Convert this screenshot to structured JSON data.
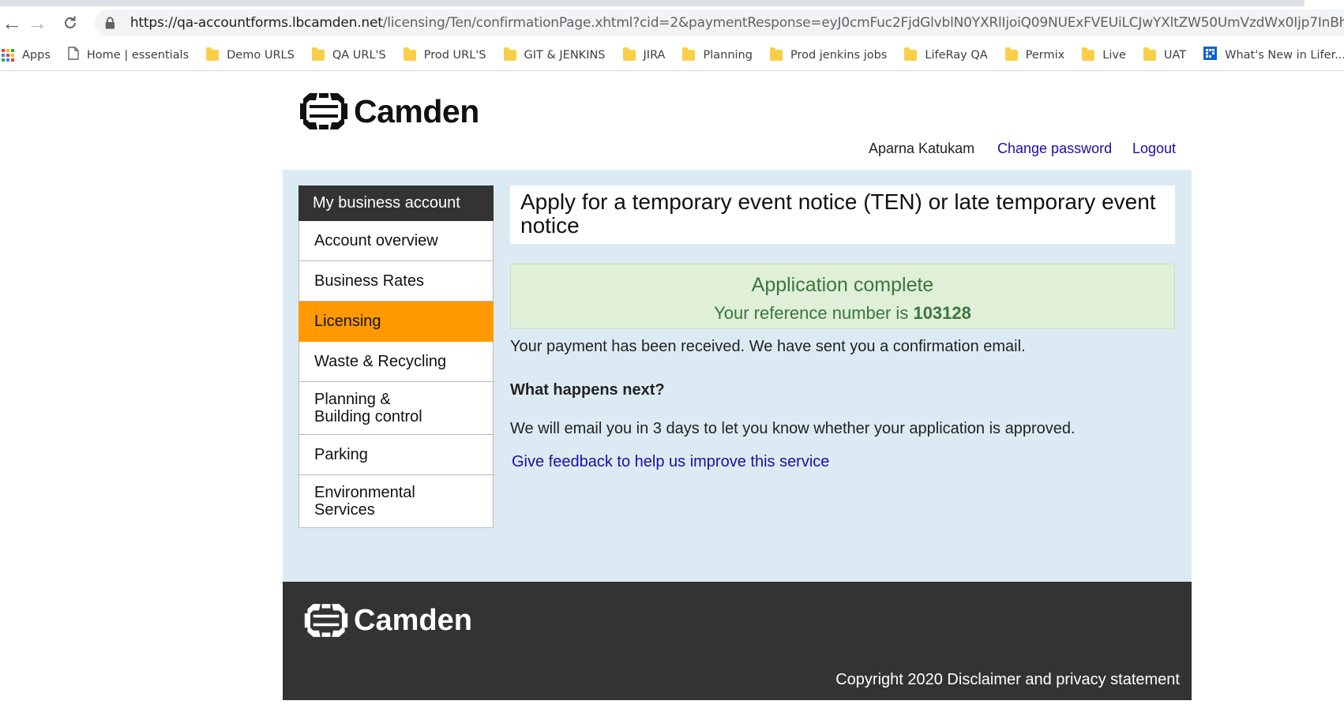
{
  "browser": {
    "url_host": "https://qa-accountforms.lbcamden.net",
    "url_rest": "/licensing/Ten/confirmationPage.xhtml?cid=2&paymentResponse=eyJ0cmFuc2FjdGlvblN0YXRlIjoiQ09NUExFVEUiLCJwYXltZW50UmVzdWx0Ijp7InBheW1lbnR...",
    "bookmarks": [
      {
        "label": "Apps",
        "icon": "apps-grid-icon"
      },
      {
        "label": "Home | essentials",
        "icon": "page-icon"
      },
      {
        "label": "Demo URLS",
        "icon": "folder-icon"
      },
      {
        "label": "QA URL'S",
        "icon": "folder-icon"
      },
      {
        "label": "Prod URL'S",
        "icon": "folder-icon"
      },
      {
        "label": "GIT & JENKINS",
        "icon": "folder-icon"
      },
      {
        "label": "JIRA",
        "icon": "folder-icon"
      },
      {
        "label": "Planning",
        "icon": "folder-icon"
      },
      {
        "label": "Prod jenkins jobs",
        "icon": "folder-icon"
      },
      {
        "label": "LifeRay QA",
        "icon": "folder-icon"
      },
      {
        "label": "Permix",
        "icon": "folder-icon"
      },
      {
        "label": "Live",
        "icon": "folder-icon"
      },
      {
        "label": "UAT",
        "icon": "folder-icon"
      },
      {
        "label": "What's New in Lifer...",
        "icon": "liferay-icon"
      }
    ]
  },
  "header": {
    "logo_text": "Camden",
    "user_name": "Aparna Katukam",
    "change_password": "Change password",
    "logout": "Logout"
  },
  "sidebar": {
    "heading": "My business account",
    "items": [
      {
        "label": "Account overview",
        "active": false
      },
      {
        "label": "Business Rates",
        "active": false
      },
      {
        "label": "Licensing",
        "active": true
      },
      {
        "label": "Waste & Recycling",
        "active": false
      },
      {
        "label": "Planning & Building control",
        "active": false
      },
      {
        "label": "Parking",
        "active": false
      },
      {
        "label": "Environmental Services",
        "active": false
      }
    ]
  },
  "main": {
    "title": "Apply for a temporary event notice (TEN) or late temporary event notice",
    "success_title": "Application complete",
    "reference_prefix": "Your reference number is",
    "reference_number": "103128",
    "payment_text": "Your payment has been received. We have sent you a confirmation email.",
    "next_heading": "What happens next?",
    "next_text": "We will email you in 3 days to let you know whether your application is approved.",
    "feedback_link": "Give feedback to help us improve this service"
  },
  "footer": {
    "logo_text": "Camden",
    "copyright": "Copyright 2020 Disclaimer and privacy statement"
  },
  "colors": {
    "accent_orange": "#ff9900",
    "panel_blue": "#dcebf3",
    "success_green": "#3c763d",
    "success_bg": "#dfefd8",
    "dark": "#333333",
    "link": "#1a0dab"
  }
}
